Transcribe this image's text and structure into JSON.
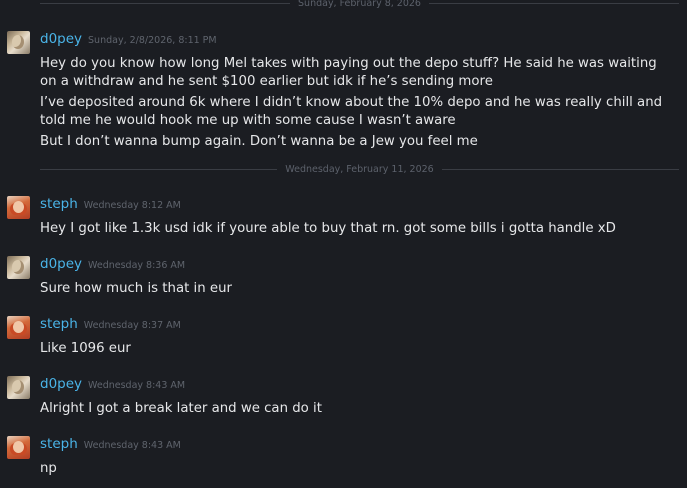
{
  "colors": {
    "background": "#1b1d22",
    "username": "#4ab4e8",
    "message_text": "#e6e7e9",
    "timestamp": "#5f646d",
    "divider_line": "#3a3d44"
  },
  "dividers": [
    {
      "label": "Sunday, February 8, 2026"
    },
    {
      "label": "Wednesday, February 11, 2026"
    }
  ],
  "messages": [
    {
      "author": "d0pey",
      "avatar": "avatar-dopey",
      "timestamp": "Sunday, 2/8/2026, 8:11 PM",
      "lines": [
        "Hey do you know how long Mel takes with paying out the depo stuff? He said he was waiting on a withdraw and he sent $100 earlier but idk if he’s sending more",
        "I’ve deposited around 6k where I didn’t know about the 10% depo and he was really chill and told me he would hook me up with some cause I wasn’t aware",
        "But I don’t wanna bump again. Don’t wanna be a Jew you feel me"
      ]
    },
    {
      "author": "steph",
      "avatar": "avatar-steph",
      "timestamp": "Wednesday 8:12 AM",
      "lines": [
        "Hey I got like 1.3k usd idk if youre able to buy that rn. got some bills i gotta handle xD"
      ]
    },
    {
      "author": "d0pey",
      "avatar": "avatar-dopey",
      "timestamp": "Wednesday 8:36 AM",
      "lines": [
        "Sure how much is that in eur"
      ]
    },
    {
      "author": "steph",
      "avatar": "avatar-steph",
      "timestamp": "Wednesday 8:37 AM",
      "lines": [
        "Like 1096 eur"
      ]
    },
    {
      "author": "d0pey",
      "avatar": "avatar-dopey",
      "timestamp": "Wednesday 8:43 AM",
      "lines": [
        "Alright I got a break later and we can do it"
      ]
    },
    {
      "author": "steph",
      "avatar": "avatar-steph",
      "timestamp": "Wednesday 8:43 AM",
      "lines": [
        "np"
      ]
    }
  ]
}
